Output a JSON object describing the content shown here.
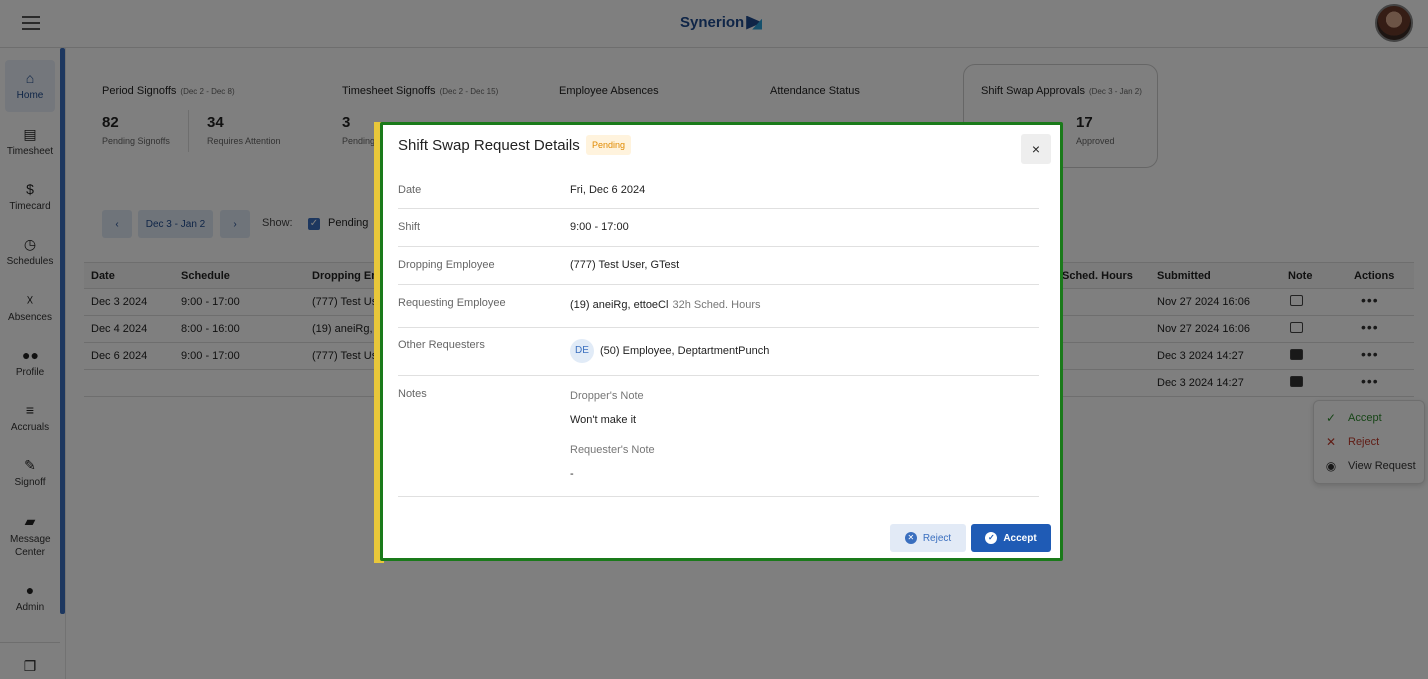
{
  "topbar": {
    "logo": "Synerion"
  },
  "sidebar": {
    "items": [
      {
        "label": "Home",
        "icon": "home-icon"
      },
      {
        "label": "Timesheet",
        "icon": "document-icon"
      },
      {
        "label": "Timecard",
        "icon": "dollar-icon"
      },
      {
        "label": "Schedules",
        "icon": "clock-icon"
      },
      {
        "label": "Absences",
        "icon": "person-x-icon"
      },
      {
        "label": "Profile",
        "icon": "people-icon"
      },
      {
        "label": "Accruals",
        "icon": "list-icon"
      },
      {
        "label": "Signoff",
        "icon": "pen-icon"
      },
      {
        "label": "Message Center",
        "icon": "chat-icon"
      },
      {
        "label": "Admin",
        "icon": "user-icon"
      }
    ]
  },
  "summary": {
    "period": {
      "title": "Period Signoffs",
      "range": "(Dec 2 - Dec 8)",
      "v1": "82",
      "l1": "Pending Signoffs",
      "v2": "34",
      "l2": "Requires Attention"
    },
    "timesheet": {
      "title": "Timesheet Signoffs",
      "range": "(Dec 2 - Dec 15)",
      "v1": "3",
      "l1": "Pending"
    },
    "absences": {
      "title": "Employee Absences"
    },
    "attendance": {
      "title": "Attendance Status"
    },
    "swap": {
      "title": "Shift Swap Approvals",
      "range": "(Dec 3 - Jan 2)",
      "v2": "17",
      "l2": "Approved"
    }
  },
  "filters": {
    "prev": "‹",
    "range": "Dec 3 - Jan 2",
    "next": "›",
    "show": "Show:",
    "pending": "Pending"
  },
  "table": {
    "headers": {
      "date": "Date",
      "schedule": "Schedule",
      "dropping": "Dropping Em",
      "sched_hours": "Sched. Hours",
      "submitted": "Submitted",
      "note": "Note",
      "actions": "Actions"
    },
    "rows": [
      {
        "date": "Dec 3 2024",
        "schedule": "9:00 - 17:00",
        "dropping": "(777) Test Us",
        "submitted": "Nov 27 2024 16:06"
      },
      {
        "date": "Dec 4 2024",
        "schedule": "8:00 - 16:00",
        "dropping": "(19) aneiRg, e",
        "submitted": "Nov 27 2024 16:06"
      },
      {
        "date": "Dec 6 2024",
        "schedule": "9:00 - 17:00",
        "dropping": "(777) Test Us",
        "submitted": "Dec 3 2024 14:27"
      },
      {
        "date": "",
        "schedule": "",
        "dropping": "",
        "submitted": "Dec 3 2024 14:27"
      }
    ]
  },
  "context_menu": {
    "accept": "Accept",
    "reject": "Reject",
    "view": "View Request"
  },
  "modal": {
    "title": "Shift Swap Request Details",
    "status": "Pending",
    "close": "×",
    "date_label": "Date",
    "date_value": "Fri, Dec 6 2024",
    "shift_label": "Shift",
    "shift_value": "9:00 - 17:00",
    "dropping_label": "Dropping Employee",
    "dropping_value": "(777) Test User, GTest",
    "requesting_label": "Requesting Employee",
    "requesting_value": "(19) aneiRg, ettoeCl",
    "requesting_hours": "32h Sched. Hours",
    "other_label": "Other Requesters",
    "other_initials": "DE",
    "other_value": "(50) Employee, DeptartmentPunch",
    "notes_label": "Notes",
    "dropper_note_label": "Dropper's Note",
    "dropper_note": "Won't make it",
    "requester_note_label": "Requester's Note",
    "requester_note": "-",
    "reject": "Reject",
    "accept": "Accept"
  }
}
